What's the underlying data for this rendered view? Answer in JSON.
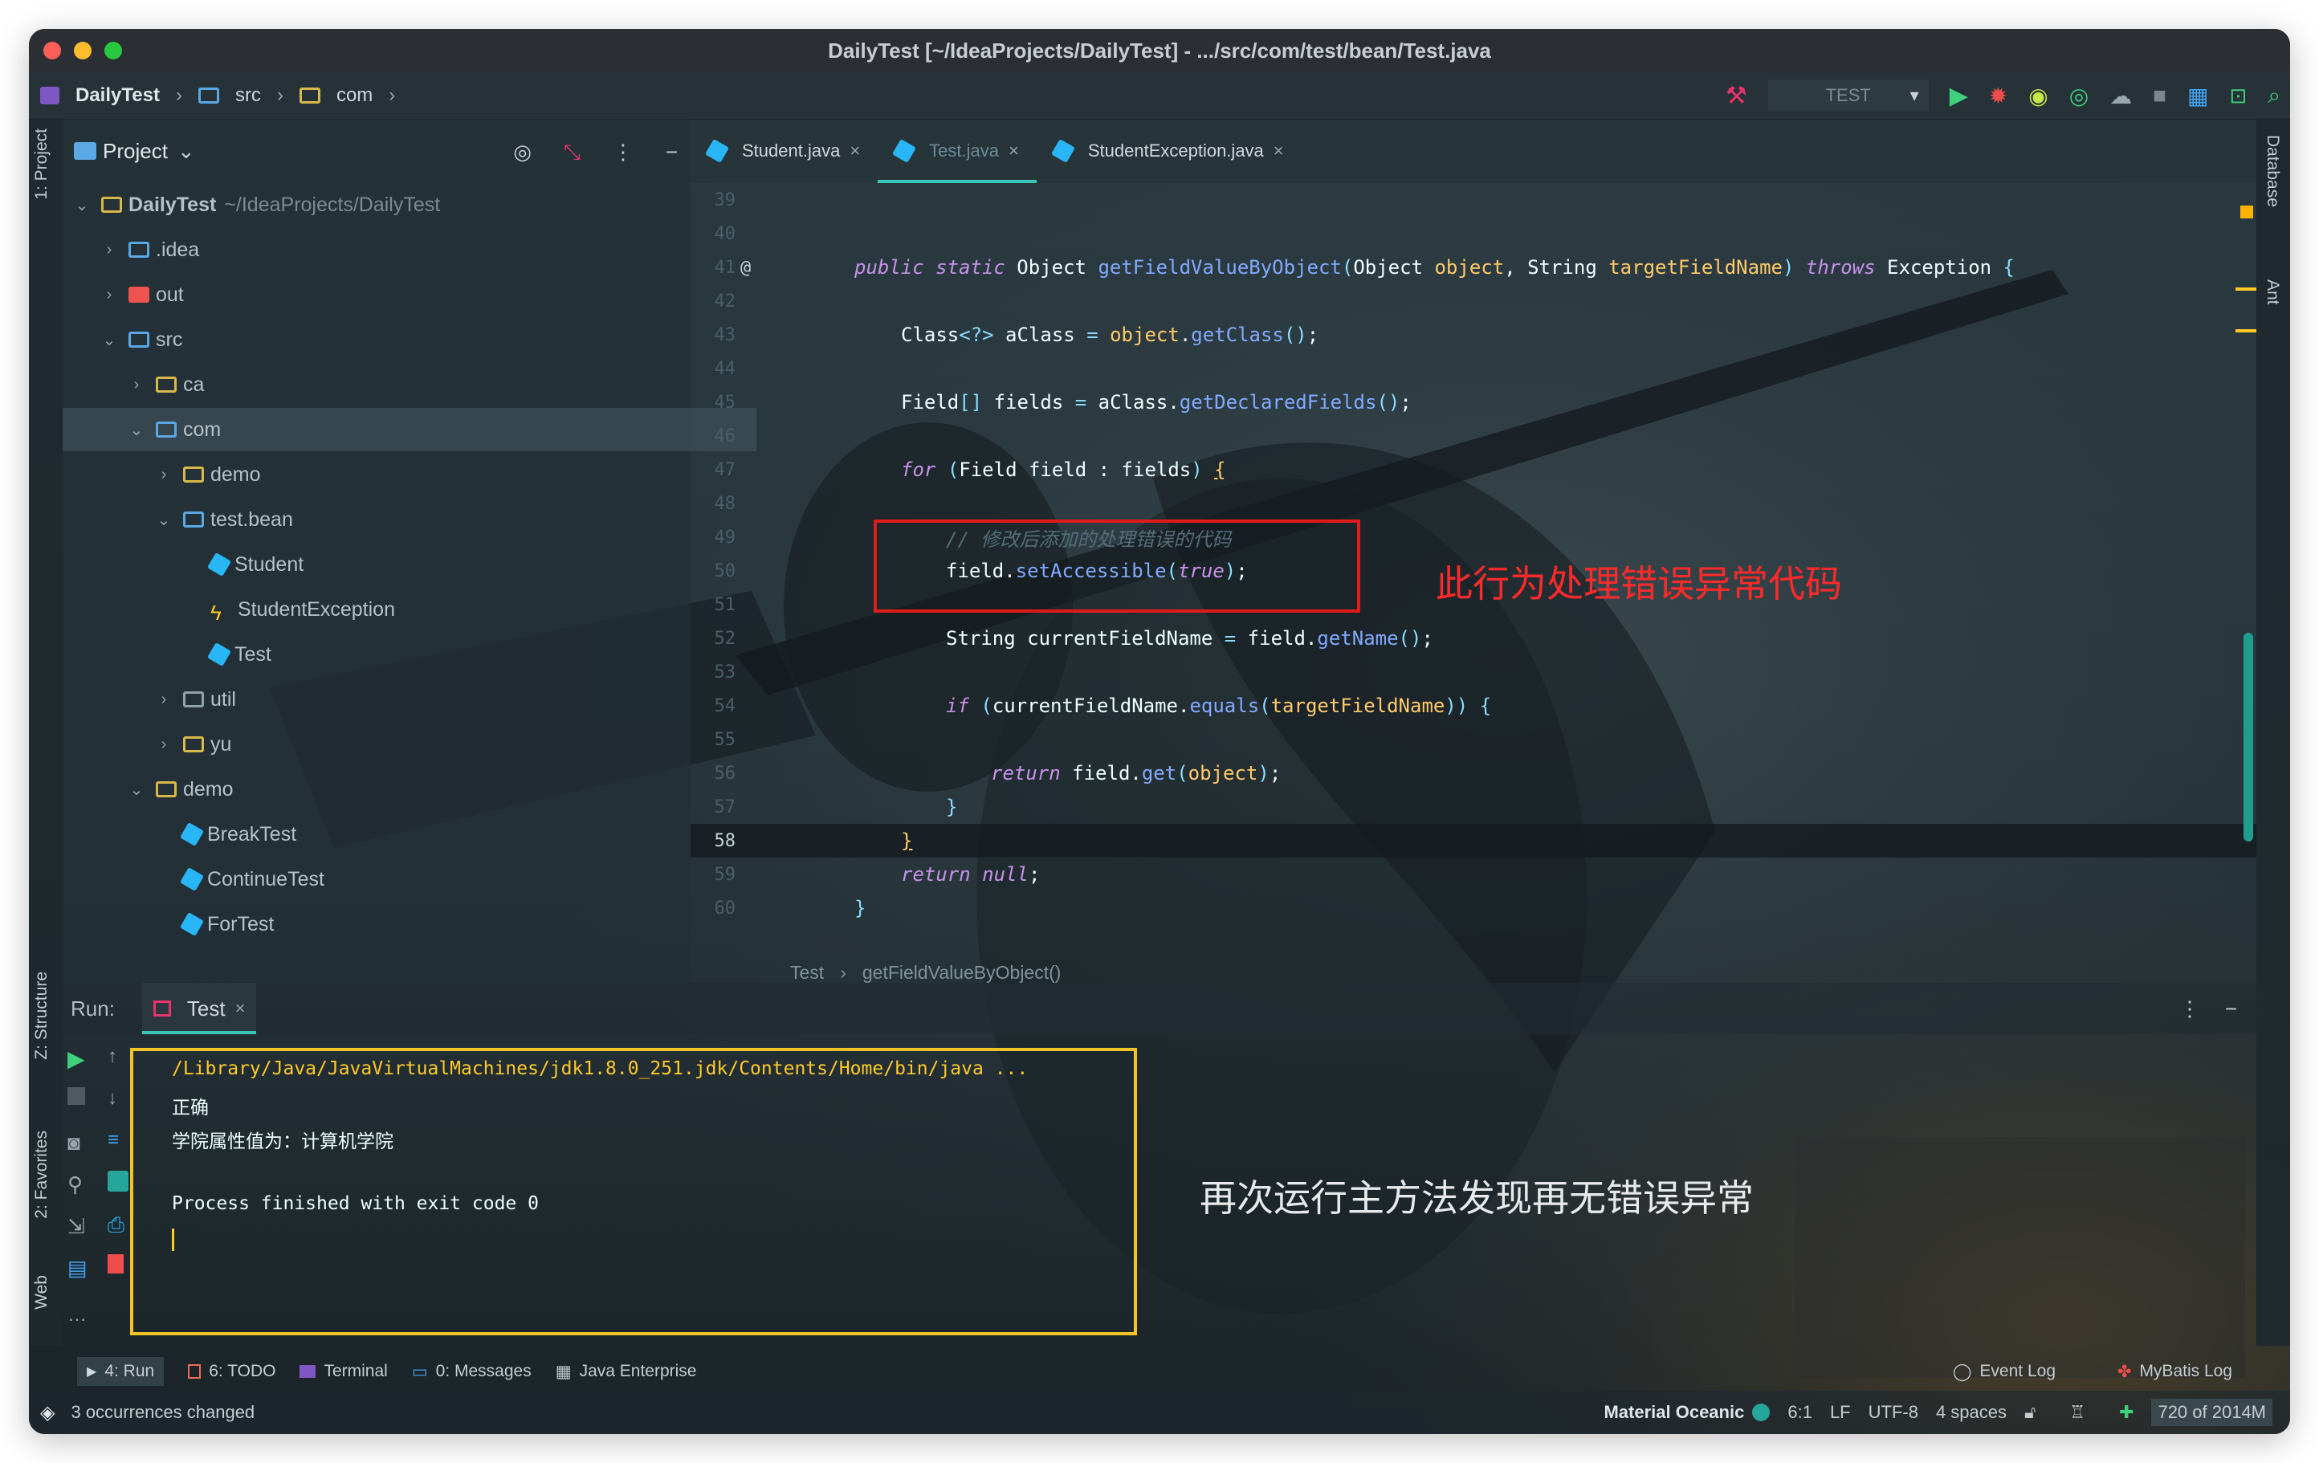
{
  "window": {
    "title": "DailyTest [~/IdeaProjects/DailyTest] - .../src/com/test/bean/Test.java"
  },
  "nav": {
    "crumbs": [
      "DailyTest",
      "src",
      "com"
    ],
    "run_config": "TEST"
  },
  "left_strip": {
    "project": "1: Project",
    "structure": "Z: Structure",
    "favorites": "2: Favorites",
    "web": "Web"
  },
  "right_strip": {
    "database": "Database",
    "ant": "Ant"
  },
  "project_panel": {
    "title": "Project",
    "tree": [
      {
        "label": "DailyTest",
        "suffix": "~/IdeaProjects/DailyTest",
        "level": 0
      },
      {
        "label": ".idea",
        "level": 1
      },
      {
        "label": "out",
        "level": 1
      },
      {
        "label": "src",
        "level": 1
      },
      {
        "label": "ca",
        "level": 2
      },
      {
        "label": "com",
        "level": 2
      },
      {
        "label": "demo",
        "level": 3
      },
      {
        "label": "test.bean",
        "level": 3
      },
      {
        "label": "Student",
        "level": 4
      },
      {
        "label": "StudentException",
        "level": 4
      },
      {
        "label": "Test",
        "level": 4
      },
      {
        "label": "util",
        "level": 3
      },
      {
        "label": "yu",
        "level": 3
      },
      {
        "label": "demo",
        "level": 2
      },
      {
        "label": "BreakTest",
        "level": 3
      },
      {
        "label": "ContinueTest",
        "level": 3
      },
      {
        "label": "ForTest",
        "level": 3
      }
    ]
  },
  "editor": {
    "tabs": [
      "Student.java",
      "Test.java",
      "StudentException.java"
    ],
    "active_tab": 1,
    "line_numbers": [
      "39",
      "40",
      "41",
      "42",
      "43",
      "44",
      "45",
      "46",
      "47",
      "48",
      "49",
      "50",
      "51",
      "52",
      "53",
      "54",
      "55",
      "56",
      "57",
      "58",
      "59",
      "60"
    ],
    "current_line": "58",
    "breadcrumb": [
      "Test",
      "getFieldValueByObject()"
    ],
    "annotation": "此行为处理错误异常代码"
  },
  "run_panel": {
    "label": "Run:",
    "tab": "Test",
    "console": [
      "/Library/Java/JavaVirtualMachines/jdk1.8.0_251.jdk/Contents/Home/bin/java ...",
      "正确",
      "学院属性值为：计算机学院",
      "",
      "Process finished with exit code 0"
    ],
    "annotation": "再次运行主方法发现再无错误异常"
  },
  "tool_windows": {
    "left": [
      "4: Run",
      "6: TODO",
      "Terminal",
      "0: Messages",
      "Java Enterprise"
    ],
    "right": [
      "Event Log",
      "MyBatis Log"
    ]
  },
  "status": {
    "message": "3 occurrences changed",
    "theme": "Material Oceanic",
    "position": "6:1",
    "line_sep": "LF",
    "encoding": "UTF-8",
    "indent": "4 spaces",
    "memory": "720 of 2014M"
  },
  "colors": {
    "accent": "#39c8b4",
    "red_annotation": "#e11b1b",
    "yellow_box": "#f2c428"
  }
}
